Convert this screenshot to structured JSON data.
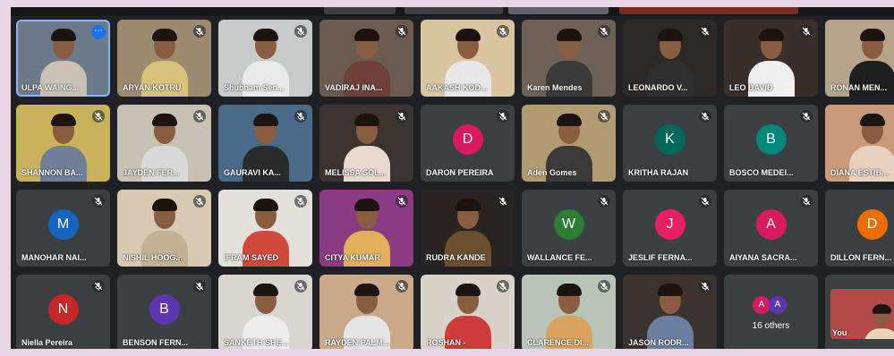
{
  "window": {
    "title": ""
  },
  "participants": [
    {
      "name": "ULPA WAING...",
      "type": "video",
      "active": true,
      "more": true,
      "bg": "#6b7b8c",
      "shirt": "#c9c2b4"
    },
    {
      "name": "ARYAN KOTRU",
      "type": "video",
      "bg": "#9d8b71",
      "shirt": "#d8c27a"
    },
    {
      "name": "Shubham Sen...",
      "type": "video",
      "bg": "#c8cac9",
      "shirt": "#e9e9e9"
    },
    {
      "name": "VADIRAJ INA...",
      "type": "video",
      "bg": "#6b5a4f",
      "shirt": "#6f4037"
    },
    {
      "name": "AAKASH KOD...",
      "type": "video",
      "bg": "#d9c4a0",
      "shirt": "#e7e7e7"
    },
    {
      "name": "Karen Mendes",
      "type": "video",
      "bg": "#6d6158",
      "shirt": "#3a3a3a"
    },
    {
      "name": "LEONARDO V...",
      "type": "video",
      "bg": "#2c2a28",
      "shirt": "#2f2f2f"
    },
    {
      "name": "LEO DAVID",
      "type": "video",
      "bg": "#3a2f2a",
      "shirt": "#efefef"
    },
    {
      "name": "RONAN MEN...",
      "type": "video",
      "bg": "#b6a38b",
      "shirt": "#1f1f1f"
    },
    {
      "name": "SHANNON BA...",
      "type": "video",
      "bg": "#c8b35c",
      "shirt": "#6f7f98"
    },
    {
      "name": "JAYDEN FER...",
      "type": "video",
      "bg": "#c7c0b3",
      "shirt": "#d9d9d9"
    },
    {
      "name": "GAURAVI KA...",
      "type": "video",
      "bg": "#4a6a8a",
      "shirt": "#2b2b2b"
    },
    {
      "name": "MELISSA SOL...",
      "type": "video",
      "bg": "#3b3431",
      "shirt": "#e8d8cf"
    },
    {
      "name": "DARON PEREIRA",
      "type": "avatar",
      "initial": "D",
      "color": "#d81b60"
    },
    {
      "name": "Aden Gomes",
      "type": "video",
      "bg": "#b29a72",
      "shirt": "#3b3b3b"
    },
    {
      "name": "KRITHA RAJAN",
      "type": "avatar",
      "initial": "K",
      "color": "#00695c"
    },
    {
      "name": "BOSCO MEDEI...",
      "type": "avatar",
      "initial": "B",
      "color": "#00897b"
    },
    {
      "name": "DIANA ESTIB...",
      "type": "video",
      "bg": "#c89a7a",
      "shirt": "#e8d0bf"
    },
    {
      "name": "MANOHAR NAI...",
      "type": "avatar",
      "initial": "M",
      "color": "#1565c0"
    },
    {
      "name": "NISHIL HOOG...",
      "type": "video",
      "bg": "#d8c9b2",
      "shirt": "#c2b293"
    },
    {
      "name": "IFRAM SAYED",
      "type": "video",
      "bg": "#e3e0dc",
      "shirt": "#d04a3c"
    },
    {
      "name": "CITYA KUMAR",
      "type": "video",
      "bg": "#8b3b82",
      "shirt": "#e0b05a"
    },
    {
      "name": "RUDRA KANDE",
      "type": "video",
      "bg": "#2a2422",
      "shirt": "#6a5030"
    },
    {
      "name": "WALLANCE FE...",
      "type": "avatar",
      "initial": "W",
      "color": "#2e7d32"
    },
    {
      "name": "JESLIF FERNA...",
      "type": "avatar",
      "initial": "J",
      "color": "#e91e63"
    },
    {
      "name": "AIYANA SACRA...",
      "type": "avatar",
      "initial": "A",
      "color": "#d81b60"
    },
    {
      "name": "DILLON FERN...",
      "type": "avatar",
      "initial": "D",
      "color": "#ef6c00"
    },
    {
      "name": "Niella Pereira",
      "type": "avatar",
      "initial": "N",
      "color": "#c62828"
    },
    {
      "name": "BENSON FERN...",
      "type": "avatar",
      "initial": "B",
      "color": "#5e35b1"
    },
    {
      "name": "SANKETH SHE...",
      "type": "video",
      "bg": "#d9d6d2",
      "shirt": "#ededed"
    },
    {
      "name": "RAYDEN PALM...",
      "type": "video",
      "bg": "#c9a98a",
      "shirt": "#e4e4e4"
    },
    {
      "name": "ROSHAN -",
      "type": "video",
      "bg": "#d8d2c8",
      "shirt": "#cf3b3b"
    },
    {
      "name": "CLARENCE DI...",
      "type": "video",
      "bg": "#b9c4b8",
      "shirt": "#d9a35e"
    },
    {
      "name": "JASON RODR...",
      "type": "video",
      "bg": "#3b342e",
      "shirt": "#6a7fa0"
    },
    {
      "name": "16 others",
      "type": "others",
      "initials": [
        "A",
        "A"
      ],
      "colors": [
        "#d81b60",
        "#5e35b1"
      ]
    },
    {
      "name": "You",
      "type": "self",
      "bg": "#b24a4a",
      "shirt": "#e8d5b8"
    }
  ],
  "footer": {
    "caption": ""
  }
}
